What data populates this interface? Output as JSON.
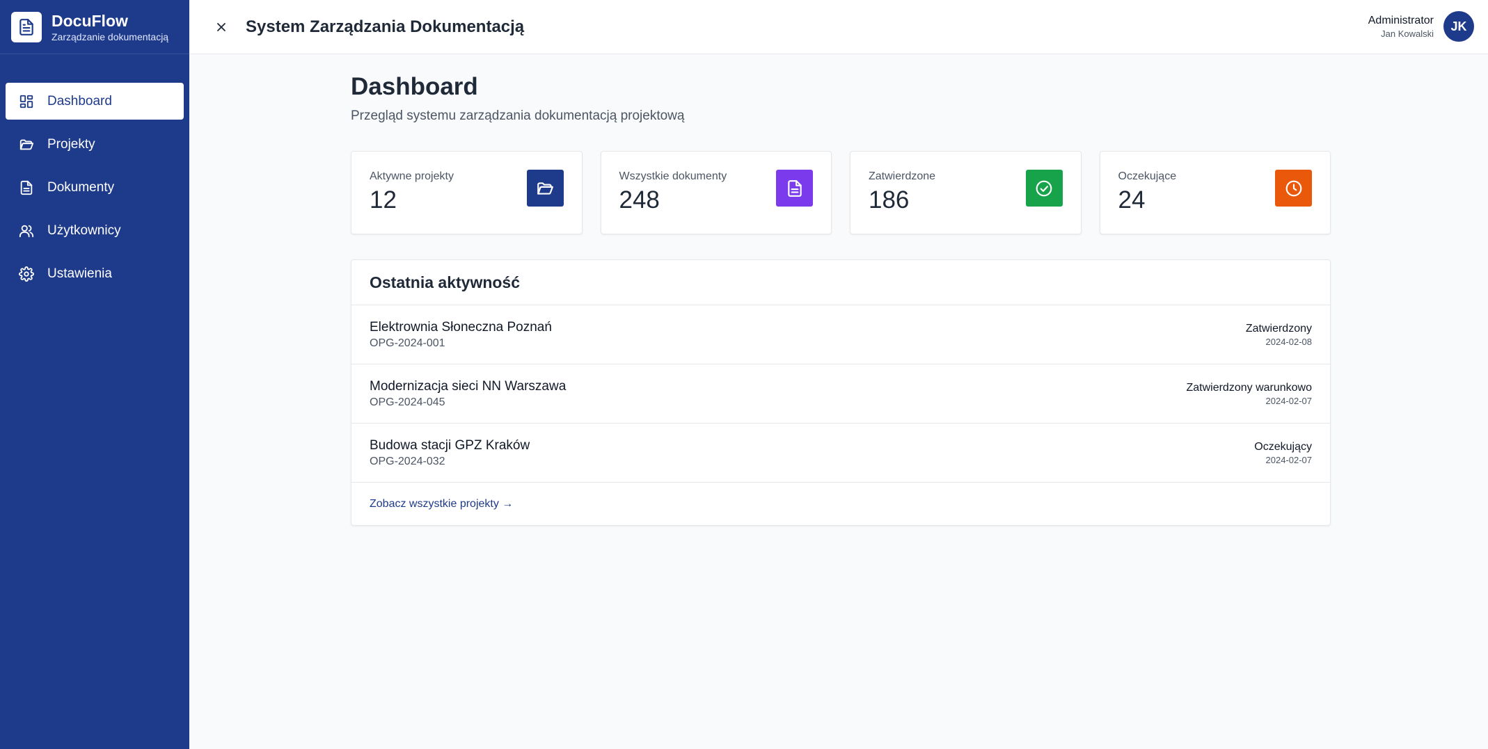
{
  "brand": {
    "name": "DocuFlow",
    "subtitle": "Zarządzanie dokumentacją",
    "logo_icon": "document-icon"
  },
  "sidebar": {
    "items": [
      {
        "label": "Dashboard",
        "icon": "dashboard-icon",
        "active": true
      },
      {
        "label": "Projekty",
        "icon": "folder-icon",
        "active": false
      },
      {
        "label": "Dokumenty",
        "icon": "document-icon",
        "active": false
      },
      {
        "label": "Użytkownicy",
        "icon": "users-icon",
        "active": false
      },
      {
        "label": "Ustawienia",
        "icon": "gear-icon",
        "active": false
      }
    ]
  },
  "header": {
    "title": "System Zarządzania Dokumentacją",
    "close_icon": "close-icon",
    "user": {
      "role": "Administrator",
      "name": "Jan Kowalski",
      "initials": "JK"
    }
  },
  "main": {
    "title": "Dashboard",
    "subtitle": "Przegląd systemu zarządzania dokumentacją projektową",
    "stats": [
      {
        "label": "Aktywne projekty",
        "value": "12",
        "icon": "folder-icon",
        "color": "#1e3a8a"
      },
      {
        "label": "Wszystkie dokumenty",
        "value": "248",
        "icon": "document-icon",
        "color": "#7c3aed"
      },
      {
        "label": "Zatwierdzone",
        "value": "186",
        "icon": "check-circle-icon",
        "color": "#16a34a"
      },
      {
        "label": "Oczekujące",
        "value": "24",
        "icon": "clock-icon",
        "color": "#ea580c"
      }
    ],
    "activity": {
      "title": "Ostatnia aktywność",
      "rows": [
        {
          "name": "Elektrownia Słoneczna Poznań",
          "code": "OPG-2024-001",
          "status": "Zatwierdzony",
          "date": "2024-02-08"
        },
        {
          "name": "Modernizacja sieci NN Warszawa",
          "code": "OPG-2024-045",
          "status": "Zatwierdzony warunkowo",
          "date": "2024-02-07"
        },
        {
          "name": "Budowa stacji GPZ Kraków",
          "code": "OPG-2024-032",
          "status": "Oczekujący",
          "date": "2024-02-07"
        }
      ],
      "link": "Zobacz wszystkie projekty →"
    }
  }
}
